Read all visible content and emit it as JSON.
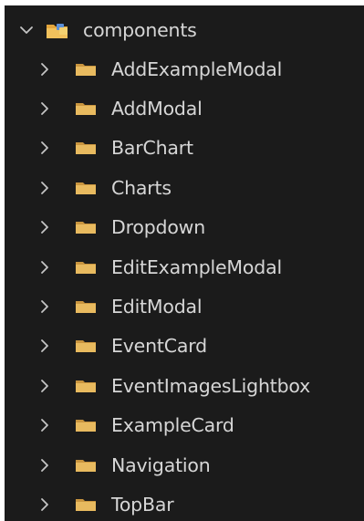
{
  "explorer": {
    "root": {
      "label": "components",
      "expanded": true,
      "icon": "special-folder-icon"
    },
    "items": [
      {
        "label": "AddExampleModal",
        "expanded": false,
        "icon": "folder-icon"
      },
      {
        "label": "AddModal",
        "expanded": false,
        "icon": "folder-icon"
      },
      {
        "label": "BarChart",
        "expanded": false,
        "icon": "folder-icon"
      },
      {
        "label": "Charts",
        "expanded": false,
        "icon": "folder-icon"
      },
      {
        "label": "Dropdown",
        "expanded": false,
        "icon": "folder-icon"
      },
      {
        "label": "EditExampleModal",
        "expanded": false,
        "icon": "folder-icon"
      },
      {
        "label": "EditModal",
        "expanded": false,
        "icon": "folder-icon"
      },
      {
        "label": "EventCard",
        "expanded": false,
        "icon": "folder-icon"
      },
      {
        "label": "EventImagesLightbox",
        "expanded": false,
        "icon": "folder-icon"
      },
      {
        "label": "ExampleCard",
        "expanded": false,
        "icon": "folder-icon"
      },
      {
        "label": "Navigation",
        "expanded": false,
        "icon": "folder-icon"
      },
      {
        "label": "TopBar",
        "expanded": false,
        "icon": "folder-icon"
      }
    ]
  },
  "colors": {
    "background": "#1b1b1b",
    "text": "#d6d6d6",
    "chevron": "#c5c5c5",
    "folder": "#e8ba5f",
    "root_folder_accent": "#5b8fd6"
  }
}
